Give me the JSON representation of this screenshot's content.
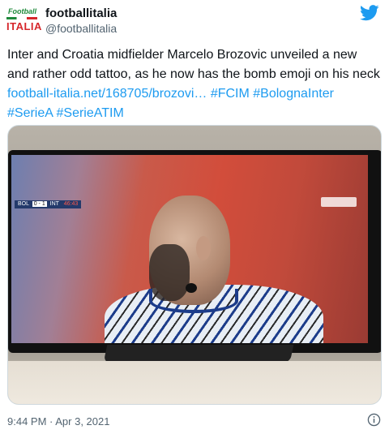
{
  "author": {
    "display_name": "footballitalia",
    "handle": "@footballitalia",
    "logo_top": "Football",
    "logo_bottom": "ITALIA"
  },
  "tweet": {
    "text_intro": "Inter and Croatia midfielder Marcelo Brozovic unveiled a new and rather odd tattoo, as he now has the bomb emoji on his neck ",
    "link": "football-italia.net/168705/brozovi…",
    "hashtags": [
      "#FCIM",
      "#BolognaInter",
      "#SerieA",
      "#SerieATIM"
    ]
  },
  "media": {
    "scorebug": {
      "home": "BOL",
      "score": "0 - 1",
      "away": "INT",
      "time": "46:43"
    }
  },
  "footer": {
    "timestamp": "9:44 PM · Apr 3, 2021"
  },
  "icons": {
    "brand": "twitter-bird-icon",
    "info": "info-icon"
  },
  "colors": {
    "link": "#1d9bf0",
    "text": "#0f1419",
    "muted": "#536471"
  }
}
